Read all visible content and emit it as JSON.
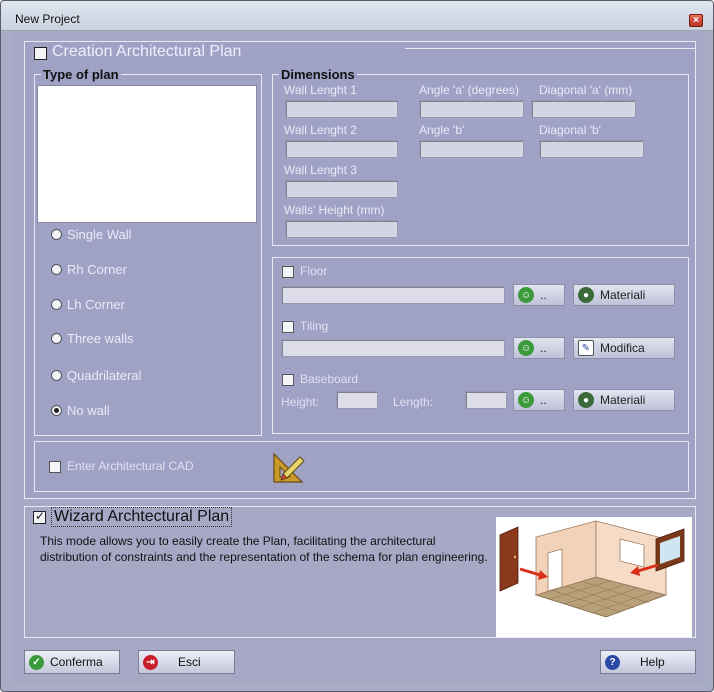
{
  "window": {
    "title": "New Project",
    "close_glyph": "×"
  },
  "creation": {
    "label": "Creation Architectural Plan",
    "checked": false
  },
  "type_of_plan": {
    "title": "Type of plan",
    "options": [
      {
        "label": "Single Wall",
        "selected": false
      },
      {
        "label": "Rh Corner",
        "selected": false
      },
      {
        "label": "Lh Corner",
        "selected": false
      },
      {
        "label": "Three walls",
        "selected": false
      },
      {
        "label": "Quadrilateral",
        "selected": false
      },
      {
        "label": "No wall",
        "selected": true
      }
    ]
  },
  "dimensions": {
    "title": "Dimensions",
    "wall_length_1": "Wall Lenght 1",
    "wall_length_2": "Wall Lenght 2",
    "wall_length_3": "Wall Lenght 3",
    "walls_height": "Walls' Height (mm)",
    "angle_a": "Angle 'a' (degrees)",
    "angle_b": "Angle 'b'",
    "diagonal_a": "Diagonal 'a' (mm)",
    "diagonal_b": "Diagonal 'b'"
  },
  "finishes": {
    "floor": {
      "label": "Floor",
      "browse": "..",
      "action": "Materiali"
    },
    "tiling": {
      "label": "Tiling",
      "browse": "..",
      "action": "Modifica"
    },
    "baseboard": {
      "label": "Baseboard",
      "height_label": "Height:",
      "length_label": "Length:",
      "browse": "..",
      "action": "Materiali"
    }
  },
  "cad": {
    "label": "Enter Architectural CAD",
    "icon": "cad-pencil-icon"
  },
  "wizard": {
    "label": "Wizard Archtectural Plan",
    "checked": true,
    "description": "This mode allows you to easily create the Plan, facilitating the architectural distribution of constraints and the representation of the schema for plan engineering.",
    "image": "room-illustration"
  },
  "buttons": {
    "confirm": "Conferma",
    "exit": "Esci",
    "help": "Help"
  },
  "colors": {
    "dialog_bg": "#a6a8c6",
    "panel_bg": "#9fa1c5",
    "confirm_icon": "#3a9a3a",
    "exit_icon": "#c8202a",
    "help_icon": "#2a4aa8"
  }
}
